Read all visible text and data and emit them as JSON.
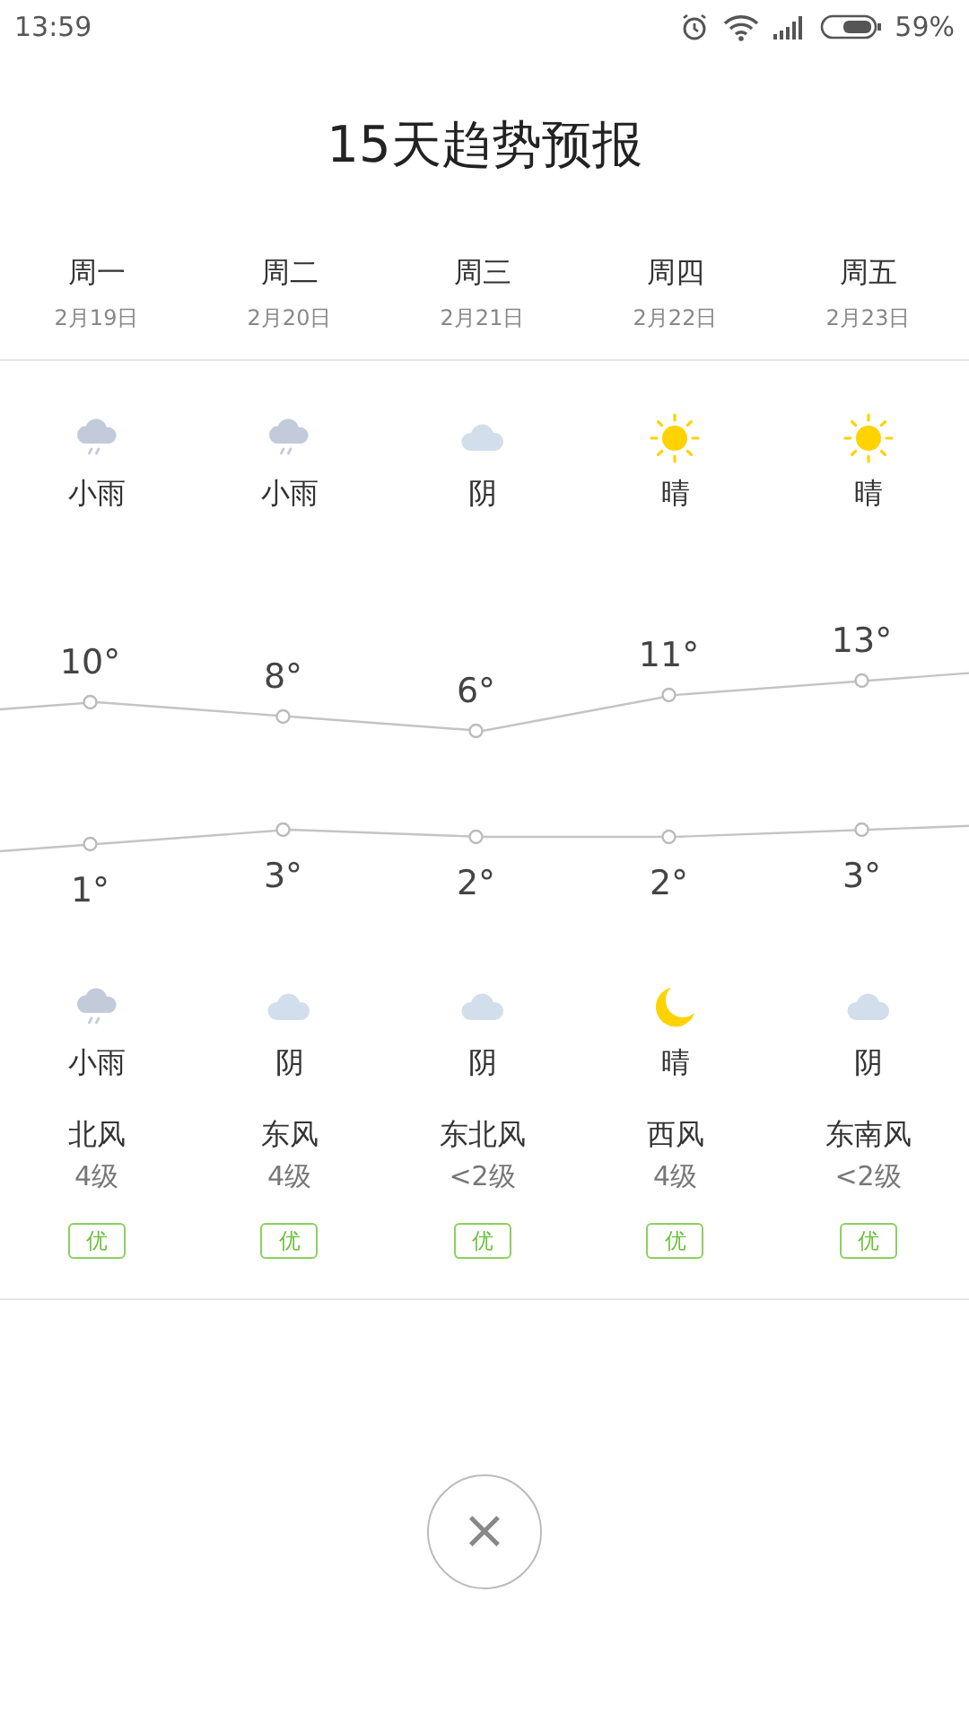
{
  "status_bar": {
    "time": "13:59",
    "battery": "59%"
  },
  "title": "15天趋势预报",
  "days": [
    {
      "weekday": "周一",
      "date": "2月19日",
      "day_icon": {
        "kind": "rain"
      },
      "day_weather": "小雨",
      "high": "10°",
      "low": "1°",
      "night_icon": {
        "kind": "rain"
      },
      "night_weather": "小雨",
      "wind_dir": "北风",
      "wind_level": "4级",
      "aqi": "优"
    },
    {
      "weekday": "周二",
      "date": "2月20日",
      "day_icon": {
        "kind": "rain"
      },
      "day_weather": "小雨",
      "high": "8°",
      "low": "3°",
      "night_icon": {
        "kind": "cloudy"
      },
      "night_weather": "阴",
      "wind_dir": "东风",
      "wind_level": "4级",
      "aqi": "优"
    },
    {
      "weekday": "周三",
      "date": "2月21日",
      "day_icon": {
        "kind": "cloudy"
      },
      "day_weather": "阴",
      "high": "6°",
      "low": "2°",
      "night_icon": {
        "kind": "cloudy"
      },
      "night_weather": "阴",
      "wind_dir": "东北风",
      "wind_level": "<2级",
      "aqi": "优"
    },
    {
      "weekday": "周四",
      "date": "2月22日",
      "day_icon": {
        "kind": "sunny"
      },
      "day_weather": "晴",
      "high": "11°",
      "low": "2°",
      "night_icon": {
        "kind": "moon"
      },
      "night_weather": "晴",
      "wind_dir": "西风",
      "wind_level": "4级",
      "aqi": "优"
    },
    {
      "weekday": "周五",
      "date": "2月23日",
      "day_icon": {
        "kind": "sunny"
      },
      "day_weather": "晴",
      "high": "13°",
      "low": "3°",
      "night_icon": {
        "kind": "cloudy"
      },
      "night_weather": "阴",
      "wind_dir": "东南风",
      "wind_level": "<2级",
      "aqi": "优"
    }
  ],
  "close_button": "×"
}
